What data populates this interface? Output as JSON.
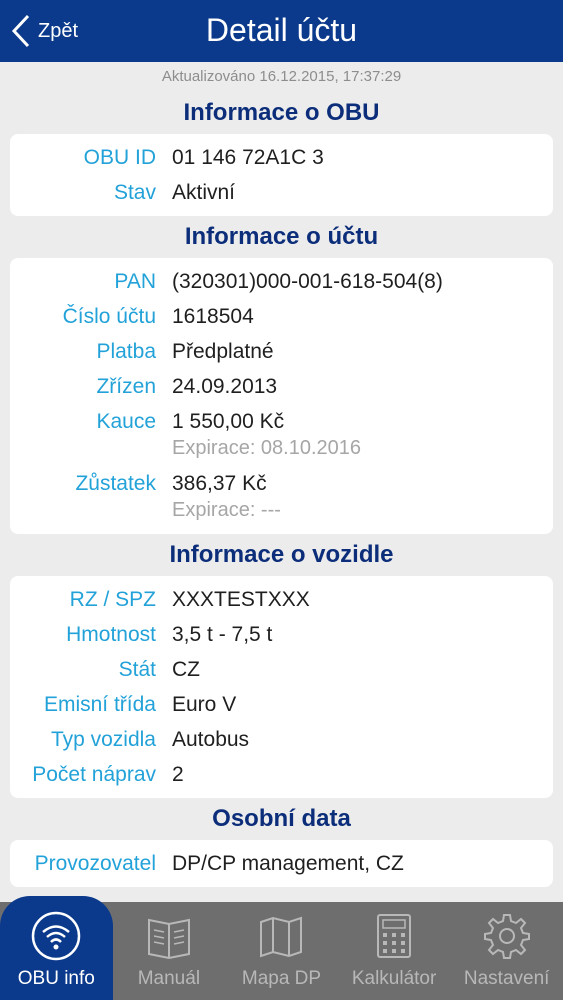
{
  "header": {
    "back_label": "Zpět",
    "title": "Detail účtu"
  },
  "updated": "Aktualizováno 16.12.2015, 17:37:29",
  "sections": {
    "obu": {
      "title": "Informace o OBU",
      "rows": [
        {
          "label": "OBU ID",
          "value": "01 146 72A1C 3"
        },
        {
          "label": "Stav",
          "value": "Aktivní"
        }
      ]
    },
    "account": {
      "title": "Informace o účtu",
      "rows": [
        {
          "label": "PAN",
          "value": "(320301)000-001-618-504(8)"
        },
        {
          "label": "Číslo účtu",
          "value": "1618504"
        },
        {
          "label": "Platba",
          "value": "Předplatné"
        },
        {
          "label": "Zřízen",
          "value": "24.09.2013"
        },
        {
          "label": "Kauce",
          "value": "1 550,00 Kč",
          "sub": "Expirace: 08.10.2016"
        },
        {
          "label": "Zůstatek",
          "value": "386,37 Kč",
          "sub": "Expirace: ---"
        }
      ]
    },
    "vehicle": {
      "title": "Informace o vozidle",
      "rows": [
        {
          "label": "RZ / SPZ",
          "value": "XXXTESTXXX"
        },
        {
          "label": "Hmotnost",
          "value": "3,5 t - 7,5 t"
        },
        {
          "label": "Stát",
          "value": "CZ"
        },
        {
          "label": "Emisní třída",
          "value": "Euro V"
        },
        {
          "label": "Typ vozidla",
          "value": "Autobus"
        },
        {
          "label": "Počet náprav",
          "value": "2"
        }
      ]
    },
    "personal": {
      "title": "Osobní data",
      "rows": [
        {
          "label": "Provozovatel",
          "value": "DP/CP management, CZ"
        }
      ]
    }
  },
  "tabs": [
    {
      "label": "OBU info",
      "icon": "wifi-icon",
      "active": true
    },
    {
      "label": "Manuál",
      "icon": "book-icon"
    },
    {
      "label": "Mapa DP",
      "icon": "map-icon"
    },
    {
      "label": "Kalkulátor",
      "icon": "calculator-icon"
    },
    {
      "label": "Nastavení",
      "icon": "gear-icon"
    }
  ],
  "colors": {
    "header": "#0b3a8c",
    "section_title": "#0b2d7a",
    "label": "#22a2d8",
    "tabbar": "#6e6e6e"
  }
}
